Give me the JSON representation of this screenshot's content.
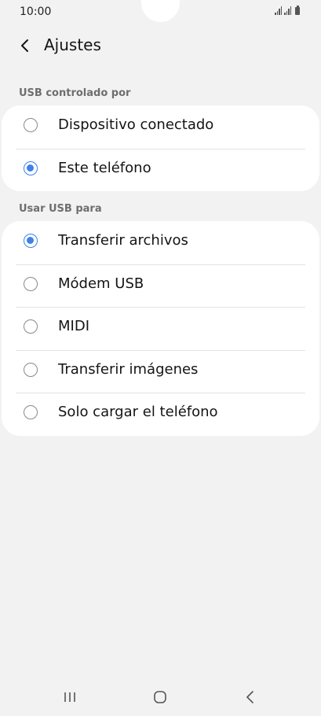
{
  "status_bar": {
    "time": "10:00"
  },
  "header": {
    "title": "Ajustes",
    "back_icon": "chevron-left-icon"
  },
  "sections": [
    {
      "label": "USB controlado por",
      "options": [
        {
          "label": "Dispositivo conectado",
          "selected": false
        },
        {
          "label": "Este teléfono",
          "selected": true
        }
      ]
    },
    {
      "label": "Usar USB para",
      "options": [
        {
          "label": "Transferir archivos",
          "selected": true
        },
        {
          "label": "Módem USB",
          "selected": false
        },
        {
          "label": "MIDI",
          "selected": false
        },
        {
          "label": "Transferir imágenes",
          "selected": false
        },
        {
          "label": "Solo cargar el teléfono",
          "selected": false
        }
      ]
    }
  ],
  "nav_bar": {
    "icons": [
      "recent-apps-icon",
      "home-icon",
      "back-icon"
    ]
  },
  "colors": {
    "background": "#f2f2f2",
    "card": "#ffffff",
    "accent": "#3e82e8",
    "section_label": "#6e6e6e"
  }
}
